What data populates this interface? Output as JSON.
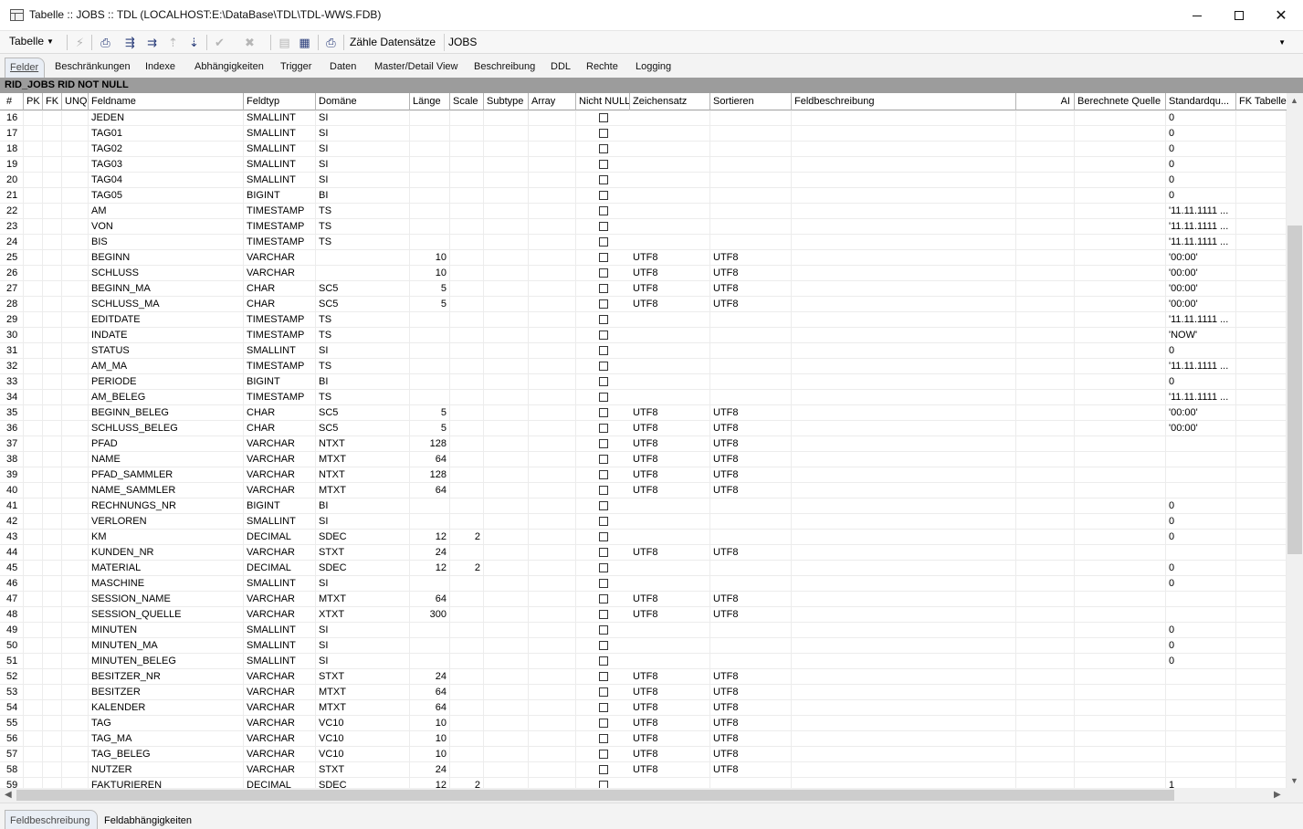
{
  "window": {
    "title": "Tabelle :: JOBS :: TDL (LOCALHOST:E:\\DataBase\\TDL\\TDL-WWS.FDB)"
  },
  "toolbar": {
    "menu_label": "Tabelle",
    "count_label": "Zähle Datensätze",
    "table_name": "JOBS"
  },
  "tabs": [
    {
      "label": "Felder",
      "active": true
    },
    {
      "label": "Beschränkungen"
    },
    {
      "label": "Indexe"
    },
    {
      "label": "Abhängigkeiten"
    },
    {
      "label": "Trigger"
    },
    {
      "label": "Daten"
    },
    {
      "label": "Master/Detail View"
    },
    {
      "label": "Beschreibung"
    },
    {
      "label": "DDL"
    },
    {
      "label": "Rechte"
    },
    {
      "label": "Logging"
    }
  ],
  "relation_header": "RID_JOBS RID NOT NULL",
  "columns": [
    "#",
    "PK",
    "FK",
    "UNQ",
    "Feldname",
    "Feldtyp",
    "Domäne",
    "Länge",
    "Scale",
    "Subtype",
    "Array",
    "Nicht NULL",
    "Zeichensatz",
    "Sortieren",
    "Feldbeschreibung",
    "AI",
    "Berechnete Quelle",
    "Standardqu...",
    "FK Tabelle"
  ],
  "rows": [
    [
      "16",
      "JEDEN",
      "SMALLINT",
      "SI",
      "",
      "",
      "",
      "",
      "0"
    ],
    [
      "17",
      "TAG01",
      "SMALLINT",
      "SI",
      "",
      "",
      "",
      "",
      "0"
    ],
    [
      "18",
      "TAG02",
      "SMALLINT",
      "SI",
      "",
      "",
      "",
      "",
      "0"
    ],
    [
      "19",
      "TAG03",
      "SMALLINT",
      "SI",
      "",
      "",
      "",
      "",
      "0"
    ],
    [
      "20",
      "TAG04",
      "SMALLINT",
      "SI",
      "",
      "",
      "",
      "",
      "0"
    ],
    [
      "21",
      "TAG05",
      "BIGINT",
      "BI",
      "",
      "",
      "",
      "",
      "0"
    ],
    [
      "22",
      "AM",
      "TIMESTAMP",
      "TS",
      "",
      "",
      "",
      "",
      "'11.11.1111 ..."
    ],
    [
      "23",
      "VON",
      "TIMESTAMP",
      "TS",
      "",
      "",
      "",
      "",
      "'11.11.1111 ..."
    ],
    [
      "24",
      "BIS",
      "TIMESTAMP",
      "TS",
      "",
      "",
      "",
      "",
      "'11.11.1111 ..."
    ],
    [
      "25",
      "BEGINN",
      "VARCHAR",
      "",
      "10",
      "",
      "UTF8",
      "UTF8",
      "'00:00'"
    ],
    [
      "26",
      "SCHLUSS",
      "VARCHAR",
      "",
      "10",
      "",
      "UTF8",
      "UTF8",
      "'00:00'"
    ],
    [
      "27",
      "BEGINN_MA",
      "CHAR",
      "SC5",
      "5",
      "",
      "UTF8",
      "UTF8",
      "'00:00'"
    ],
    [
      "28",
      "SCHLUSS_MA",
      "CHAR",
      "SC5",
      "5",
      "",
      "UTF8",
      "UTF8",
      "'00:00'"
    ],
    [
      "29",
      "EDITDATE",
      "TIMESTAMP",
      "TS",
      "",
      "",
      "",
      "",
      "'11.11.1111 ..."
    ],
    [
      "30",
      "INDATE",
      "TIMESTAMP",
      "TS",
      "",
      "",
      "",
      "",
      "'NOW'"
    ],
    [
      "31",
      "STATUS",
      "SMALLINT",
      "SI",
      "",
      "",
      "",
      "",
      "0"
    ],
    [
      "32",
      "AM_MA",
      "TIMESTAMP",
      "TS",
      "",
      "",
      "",
      "",
      "'11.11.1111 ..."
    ],
    [
      "33",
      "PERIODE",
      "BIGINT",
      "BI",
      "",
      "",
      "",
      "",
      "0"
    ],
    [
      "34",
      "AM_BELEG",
      "TIMESTAMP",
      "TS",
      "",
      "",
      "",
      "",
      "'11.11.1111 ..."
    ],
    [
      "35",
      "BEGINN_BELEG",
      "CHAR",
      "SC5",
      "5",
      "",
      "UTF8",
      "UTF8",
      "'00:00'"
    ],
    [
      "36",
      "SCHLUSS_BELEG",
      "CHAR",
      "SC5",
      "5",
      "",
      "UTF8",
      "UTF8",
      "'00:00'"
    ],
    [
      "37",
      "PFAD",
      "VARCHAR",
      "NTXT",
      "128",
      "",
      "UTF8",
      "UTF8",
      ""
    ],
    [
      "38",
      "NAME",
      "VARCHAR",
      "MTXT",
      "64",
      "",
      "UTF8",
      "UTF8",
      ""
    ],
    [
      "39",
      "PFAD_SAMMLER",
      "VARCHAR",
      "NTXT",
      "128",
      "",
      "UTF8",
      "UTF8",
      ""
    ],
    [
      "40",
      "NAME_SAMMLER",
      "VARCHAR",
      "MTXT",
      "64",
      "",
      "UTF8",
      "UTF8",
      ""
    ],
    [
      "41",
      "RECHNUNGS_NR",
      "BIGINT",
      "BI",
      "",
      "",
      "",
      "",
      "0"
    ],
    [
      "42",
      "VERLOREN",
      "SMALLINT",
      "SI",
      "",
      "",
      "",
      "",
      "0"
    ],
    [
      "43",
      "KM",
      "DECIMAL",
      "SDEC",
      "12",
      "2",
      "",
      "",
      "0"
    ],
    [
      "44",
      "KUNDEN_NR",
      "VARCHAR",
      "STXT",
      "24",
      "",
      "UTF8",
      "UTF8",
      ""
    ],
    [
      "45",
      "MATERIAL",
      "DECIMAL",
      "SDEC",
      "12",
      "2",
      "",
      "",
      "0"
    ],
    [
      "46",
      "MASCHINE",
      "SMALLINT",
      "SI",
      "",
      "",
      "",
      "",
      "0"
    ],
    [
      "47",
      "SESSION_NAME",
      "VARCHAR",
      "MTXT",
      "64",
      "",
      "UTF8",
      "UTF8",
      ""
    ],
    [
      "48",
      "SESSION_QUELLE",
      "VARCHAR",
      "XTXT",
      "300",
      "",
      "UTF8",
      "UTF8",
      ""
    ],
    [
      "49",
      "MINUTEN",
      "SMALLINT",
      "SI",
      "",
      "",
      "",
      "",
      "0"
    ],
    [
      "50",
      "MINUTEN_MA",
      "SMALLINT",
      "SI",
      "",
      "",
      "",
      "",
      "0"
    ],
    [
      "51",
      "MINUTEN_BELEG",
      "SMALLINT",
      "SI",
      "",
      "",
      "",
      "",
      "0"
    ],
    [
      "52",
      "BESITZER_NR",
      "VARCHAR",
      "STXT",
      "24",
      "",
      "UTF8",
      "UTF8",
      ""
    ],
    [
      "53",
      "BESITZER",
      "VARCHAR",
      "MTXT",
      "64",
      "",
      "UTF8",
      "UTF8",
      ""
    ],
    [
      "54",
      "KALENDER",
      "VARCHAR",
      "MTXT",
      "64",
      "",
      "UTF8",
      "UTF8",
      ""
    ],
    [
      "55",
      "TAG",
      "VARCHAR",
      "VC10",
      "10",
      "",
      "UTF8",
      "UTF8",
      ""
    ],
    [
      "56",
      "TAG_MA",
      "VARCHAR",
      "VC10",
      "10",
      "",
      "UTF8",
      "UTF8",
      ""
    ],
    [
      "57",
      "TAG_BELEG",
      "VARCHAR",
      "VC10",
      "10",
      "",
      "UTF8",
      "UTF8",
      ""
    ],
    [
      "58",
      "NUTZER",
      "VARCHAR",
      "STXT",
      "24",
      "",
      "UTF8",
      "UTF8",
      ""
    ],
    [
      "59",
      "FAKTURIEREN",
      "DECIMAL",
      "SDEC",
      "12",
      "2",
      "",
      "",
      "1"
    ]
  ],
  "bottom_tabs": [
    {
      "label": "Feldbeschreibung",
      "active": true
    },
    {
      "label": "Feldabhängigkeiten"
    }
  ],
  "icons": [
    "table-icon",
    "refresh-icon",
    "export-icon",
    "add-field-icon",
    "insert-field-icon",
    "move-up-icon",
    "move-down-icon",
    "commit-icon",
    "rollback-icon",
    "grid-icon",
    "print-icon"
  ]
}
